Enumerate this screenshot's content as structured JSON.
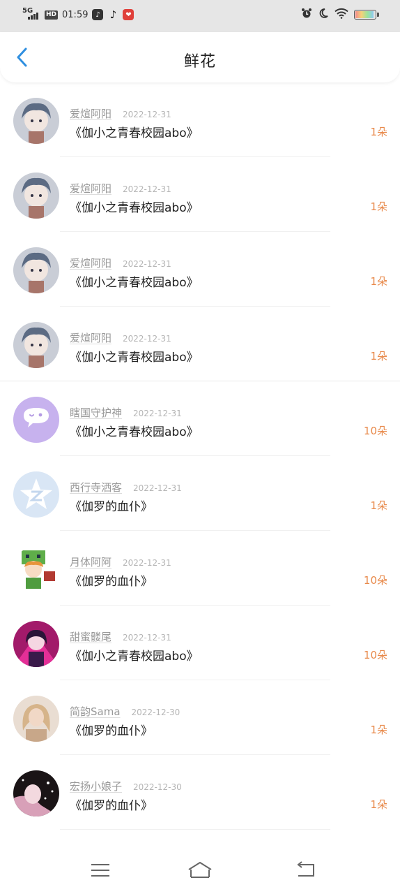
{
  "status_bar": {
    "network": "5G",
    "hd": "HD",
    "time": "01:59",
    "icons": [
      "tiktok-lite-icon",
      "tiktok-icon",
      "red-app-icon",
      "alarm-icon",
      "moon-icon",
      "wifi-icon",
      "battery-icon"
    ]
  },
  "header": {
    "title": "鲜花",
    "back_icon": "chevron-left-icon"
  },
  "colors": {
    "accent_blue": "#2f8fe0",
    "count_orange": "#e8894a",
    "meta_gray": "#999999"
  },
  "items": [
    {
      "user": "爱煊阿阳",
      "date": "2022-12-31",
      "title": "《伽小之青春校园abo》",
      "count": "1朵",
      "avatar": "anime-boy-avatar"
    },
    {
      "user": "爱煊阿阳",
      "date": "2022-12-31",
      "title": "《伽小之青春校园abo》",
      "count": "1朵",
      "avatar": "anime-boy-avatar"
    },
    {
      "user": "爱煊阿阳",
      "date": "2022-12-31",
      "title": "《伽小之青春校园abo》",
      "count": "1朵",
      "avatar": "anime-boy-avatar"
    },
    {
      "user": "爱煊阿阳",
      "date": "2022-12-31",
      "title": "《伽小之青春校园abo》",
      "count": "1朵",
      "avatar": "anime-boy-avatar"
    },
    {
      "user": "瞎国守护神",
      "date": "2022-12-31",
      "title": "《伽小之青春校园abo》",
      "count": "10朵",
      "avatar": "chat-bubble-avatar"
    },
    {
      "user": "西行寺洒客",
      "date": "2022-12-31",
      "title": "《伽罗的血仆》",
      "count": "1朵",
      "avatar": "qzone-star-avatar"
    },
    {
      "user": "月体阿阿",
      "date": "2022-12-31",
      "title": "《伽罗的血仆》",
      "count": "10朵",
      "avatar": "creeper-girl-avatar"
    },
    {
      "user": "甜蜜髅尾",
      "date": "2022-12-31",
      "title": "《伽小之青春校园abo》",
      "count": "10朵",
      "avatar": "neon-girl-avatar"
    },
    {
      "user": "简韵Sama",
      "date": "2022-12-30",
      "title": "《伽罗的血仆》",
      "count": "1朵",
      "avatar": "blonde-girl-avatar"
    },
    {
      "user": "宏扬小娘子",
      "date": "2022-12-30",
      "title": "《伽罗的血仆》",
      "count": "1朵",
      "avatar": "sparkle-girl-avatar"
    }
  ],
  "bottom_nav": {
    "buttons": [
      "menu-icon",
      "home-icon",
      "back-icon"
    ]
  }
}
